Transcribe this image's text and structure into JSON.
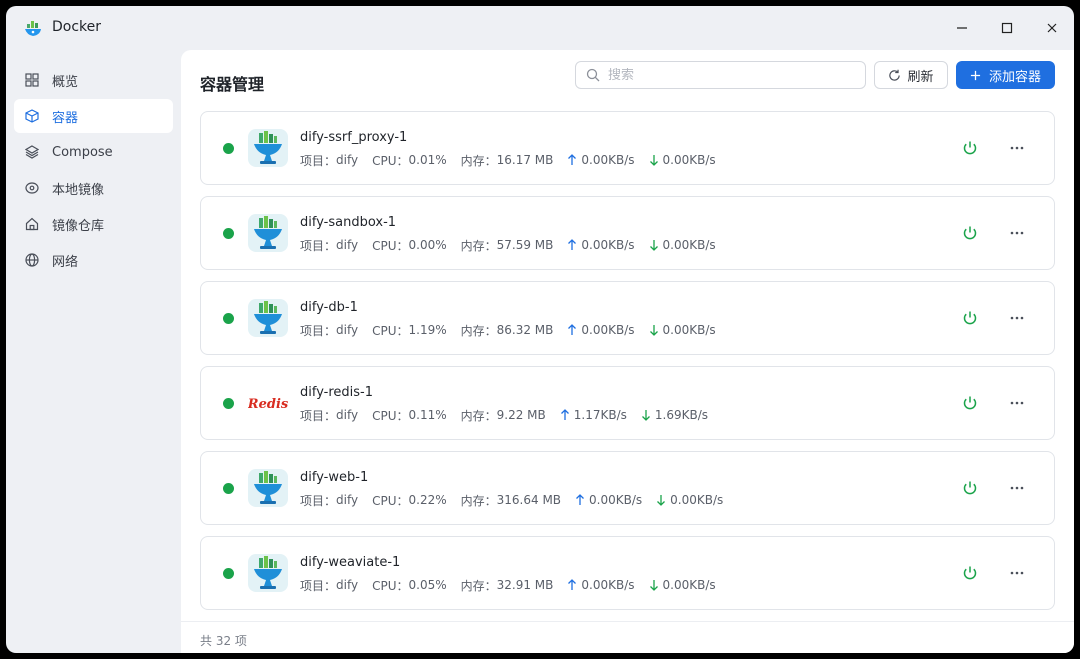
{
  "window": {
    "title": "Docker"
  },
  "sidebar": {
    "items": [
      {
        "label": "概览",
        "icon": "grid-icon",
        "active": false
      },
      {
        "label": "容器",
        "icon": "cube-icon",
        "active": true
      },
      {
        "label": "Compose",
        "icon": "layers-icon",
        "active": false
      },
      {
        "label": "本地镜像",
        "icon": "disc-icon",
        "active": false
      },
      {
        "label": "镜像仓库",
        "icon": "house-icon",
        "active": false
      },
      {
        "label": "网络",
        "icon": "globe-icon",
        "active": false
      }
    ]
  },
  "main": {
    "title": "容器管理",
    "search": {
      "placeholder": "搜索",
      "value": ""
    },
    "refresh_label": "刷新",
    "add_label": "添加容器"
  },
  "labels": {
    "project": "项目：",
    "cpu": "CPU：",
    "memory": "内存："
  },
  "containers": [
    {
      "name": "dify-ssrf_proxy-1",
      "project": "dify",
      "cpu": "0.01%",
      "memory": "16.17 MB",
      "up": "0.00KB/s",
      "down": "0.00KB/s",
      "logo": "dify",
      "status": "running"
    },
    {
      "name": "dify-sandbox-1",
      "project": "dify",
      "cpu": "0.00%",
      "memory": "57.59 MB",
      "up": "0.00KB/s",
      "down": "0.00KB/s",
      "logo": "dify",
      "status": "running"
    },
    {
      "name": "dify-db-1",
      "project": "dify",
      "cpu": "1.19%",
      "memory": "86.32 MB",
      "up": "0.00KB/s",
      "down": "0.00KB/s",
      "logo": "dify",
      "status": "running"
    },
    {
      "name": "dify-redis-1",
      "project": "dify",
      "cpu": "0.11%",
      "memory": "9.22 MB",
      "up": "1.17KB/s",
      "down": "1.69KB/s",
      "logo": "redis",
      "logo_text": "Redis",
      "status": "running"
    },
    {
      "name": "dify-web-1",
      "project": "dify",
      "cpu": "0.22%",
      "memory": "316.64 MB",
      "up": "0.00KB/s",
      "down": "0.00KB/s",
      "logo": "dify",
      "status": "running"
    },
    {
      "name": "dify-weaviate-1",
      "project": "dify",
      "cpu": "0.05%",
      "memory": "32.91 MB",
      "up": "0.00KB/s",
      "down": "0.00KB/s",
      "logo": "dify",
      "status": "running"
    }
  ],
  "footer": {
    "total": "共 32 项"
  },
  "colors": {
    "accent": "#1f6fe0",
    "running": "#1aa34a",
    "power": "#1aa34a",
    "upload_arrow": "#1f6fe0",
    "download_arrow": "#1aa34a",
    "redis": "#d82c20"
  }
}
